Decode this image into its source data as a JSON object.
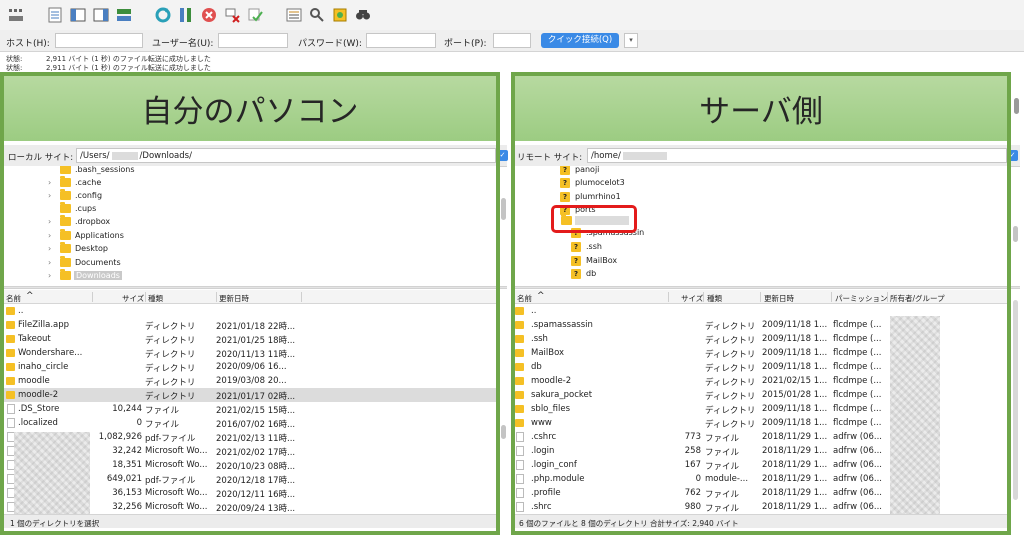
{
  "toolbar": {
    "icons": [
      "site-manager-icon",
      "message-log-icon",
      "local-tree-icon",
      "remote-tree-icon",
      "transfer-queue-icon",
      "refresh-icon",
      "process-queue-icon",
      "cancel-icon",
      "disconnect-icon",
      "reconnect-icon",
      "filter-icon",
      "compare-icon",
      "sync-browse-icon",
      "search-icon"
    ]
  },
  "quickconnect": {
    "host_label": "ホスト(H):",
    "user_label": "ユーザー名(U):",
    "pass_label": "パスワード(W):",
    "port_label": "ポート(P):",
    "connect_label": "クイック接続(Q)",
    "dropdown_glyph": "▾"
  },
  "log": [
    {
      "label": "状態:",
      "text": "2,911 バイト (1 秒) のファイル転送に成功しました"
    },
    {
      "label": "状態:",
      "text": "2,911 バイト (1 秒) のファイル転送に成功しました"
    }
  ],
  "annotations": {
    "local_banner": "自分のパソコン",
    "remote_banner": "サーバ側"
  },
  "local": {
    "site_label": "ローカル サイト:",
    "path_prefix": "/Users/",
    "path_suffix": "/Downloads/",
    "tree": [
      {
        "name": ".bash_sessions",
        "chevron": false
      },
      {
        "name": ".cache",
        "chevron": true
      },
      {
        "name": ".config",
        "chevron": true
      },
      {
        "name": ".cups",
        "chevron": false
      },
      {
        "name": ".dropbox",
        "chevron": true
      },
      {
        "name": "Applications",
        "chevron": true
      },
      {
        "name": "Desktop",
        "chevron": true
      },
      {
        "name": "Documents",
        "chevron": true
      },
      {
        "name": "Downloads",
        "chevron": true,
        "selected": true
      }
    ],
    "columns": {
      "name": "名前",
      "size": "サイズ",
      "type": "種類",
      "modified": "更新日時"
    },
    "rows": [
      {
        "name": "..",
        "size": "",
        "type": "",
        "modified": "",
        "icon": "folder"
      },
      {
        "name": "FileZilla.app",
        "size": "",
        "type": "ディレクトリ",
        "modified": "2021/01/18 22時...",
        "icon": "folder"
      },
      {
        "name": "Takeout",
        "size": "",
        "type": "ディレクトリ",
        "modified": "2021/01/25 18時...",
        "icon": "folder"
      },
      {
        "name": "Wondershare...",
        "size": "",
        "type": "ディレクトリ",
        "modified": "2020/11/13 11時...",
        "icon": "folder"
      },
      {
        "name": "inaho_circle",
        "size": "",
        "type": "ディレクトリ",
        "modified": "2020/09/06 16...",
        "icon": "folder"
      },
      {
        "name": "moodle",
        "size": "",
        "type": "ディレクトリ",
        "modified": "2019/03/08 20...",
        "icon": "folder"
      },
      {
        "name": "moodle-2",
        "size": "",
        "type": "ディレクトリ",
        "modified": "2021/01/17 02時...",
        "icon": "folder",
        "selected": true
      },
      {
        "name": ".DS_Store",
        "size": "10,244",
        "type": "ファイル",
        "modified": "2021/02/15 15時...",
        "icon": "doc"
      },
      {
        "name": ".localized",
        "size": "0",
        "type": "ファイル",
        "modified": "2016/07/02 16時...",
        "icon": "doc"
      },
      {
        "name": "",
        "size": "1,082,926",
        "type": "pdf-ファイル",
        "modified": "2021/02/13 11時...",
        "icon": "doc"
      },
      {
        "name": "",
        "size": "32,242",
        "type": "Microsoft Wo...",
        "modified": "2021/02/02 17時...",
        "icon": "doc"
      },
      {
        "name": "",
        "size": "18,351",
        "type": "Microsoft Wo...",
        "modified": "2020/10/23 08時...",
        "icon": "doc"
      },
      {
        "name": "",
        "size": "649,021",
        "type": "pdf-ファイル",
        "modified": "2020/12/18 17時...",
        "icon": "doc"
      },
      {
        "name": "",
        "size": "36,153",
        "type": "Microsoft Wo...",
        "modified": "2020/12/11 16時...",
        "icon": "doc"
      },
      {
        "name": "",
        "size": "32,256",
        "type": "Microsoft Wo...",
        "modified": "2020/09/24 13時...",
        "icon": "doc"
      }
    ],
    "status": "1 個のディレクトリを選択"
  },
  "remote": {
    "site_label": "リモート サイト:",
    "path_prefix": "/home/",
    "path_suffix": "",
    "tree": [
      {
        "name": "panoji"
      },
      {
        "name": "plumocelot3"
      },
      {
        "name": "plumrhino1"
      },
      {
        "name": "ports"
      },
      {
        "name": "",
        "folder": true,
        "highlight": true
      },
      {
        "name": ".spamassassin",
        "indent": true
      },
      {
        "name": ".ssh",
        "indent": true
      },
      {
        "name": "MailBox",
        "indent": true
      },
      {
        "name": "db",
        "indent": true
      }
    ],
    "columns": {
      "name": "名前",
      "size": "サイズ",
      "type": "種類",
      "modified": "更新日時",
      "perm": "パーミッション",
      "owner": "所有者/グループ"
    },
    "rows": [
      {
        "name": "..",
        "size": "",
        "type": "",
        "modified": "",
        "perm": "",
        "icon": "folder"
      },
      {
        "name": ".spamassassin",
        "size": "",
        "type": "ディレクトリ",
        "modified": "2009/11/18 1...",
        "perm": "flcdmpe (...",
        "icon": "folder"
      },
      {
        "name": ".ssh",
        "size": "",
        "type": "ディレクトリ",
        "modified": "2009/11/18 1...",
        "perm": "flcdmpe (...",
        "icon": "folder"
      },
      {
        "name": "MailBox",
        "size": "",
        "type": "ディレクトリ",
        "modified": "2009/11/18 1...",
        "perm": "flcdmpe (...",
        "icon": "folder"
      },
      {
        "name": "db",
        "size": "",
        "type": "ディレクトリ",
        "modified": "2009/11/18 1...",
        "perm": "flcdmpe (...",
        "icon": "folder"
      },
      {
        "name": "moodle-2",
        "size": "",
        "type": "ディレクトリ",
        "modified": "2021/02/15 1...",
        "perm": "flcdmpe (...",
        "icon": "folder"
      },
      {
        "name": "sakura_pocket",
        "size": "",
        "type": "ディレクトリ",
        "modified": "2015/01/28 1...",
        "perm": "flcdmpe (...",
        "icon": "folder"
      },
      {
        "name": "sblo_files",
        "size": "",
        "type": "ディレクトリ",
        "modified": "2009/11/18 1...",
        "perm": "flcdmpe (...",
        "icon": "folder"
      },
      {
        "name": "www",
        "size": "",
        "type": "ディレクトリ",
        "modified": "2009/11/18 1...",
        "perm": "flcdmpe (...",
        "icon": "folder"
      },
      {
        "name": ".cshrc",
        "size": "773",
        "type": "ファイル",
        "modified": "2018/11/29 1...",
        "perm": "adfrw (06...",
        "icon": "doc"
      },
      {
        "name": ".login",
        "size": "258",
        "type": "ファイル",
        "modified": "2018/11/29 1...",
        "perm": "adfrw (06...",
        "icon": "doc"
      },
      {
        "name": ".login_conf",
        "size": "167",
        "type": "ファイル",
        "modified": "2018/11/29 1...",
        "perm": "adfrw (06...",
        "icon": "doc"
      },
      {
        "name": ".php.module",
        "size": "0",
        "type": "module-...",
        "modified": "2018/11/29 1...",
        "perm": "adfrw (06...",
        "icon": "doc"
      },
      {
        "name": ".profile",
        "size": "762",
        "type": "ファイル",
        "modified": "2018/11/29 1...",
        "perm": "adfrw (06...",
        "icon": "doc"
      },
      {
        "name": ".shrc",
        "size": "980",
        "type": "ファイル",
        "modified": "2018/11/29 1...",
        "perm": "adfrw (06...",
        "icon": "doc"
      }
    ],
    "status": "6 個のファイルと 8 個のディレクトリ 合計サイズ: 2,940 バイト"
  }
}
